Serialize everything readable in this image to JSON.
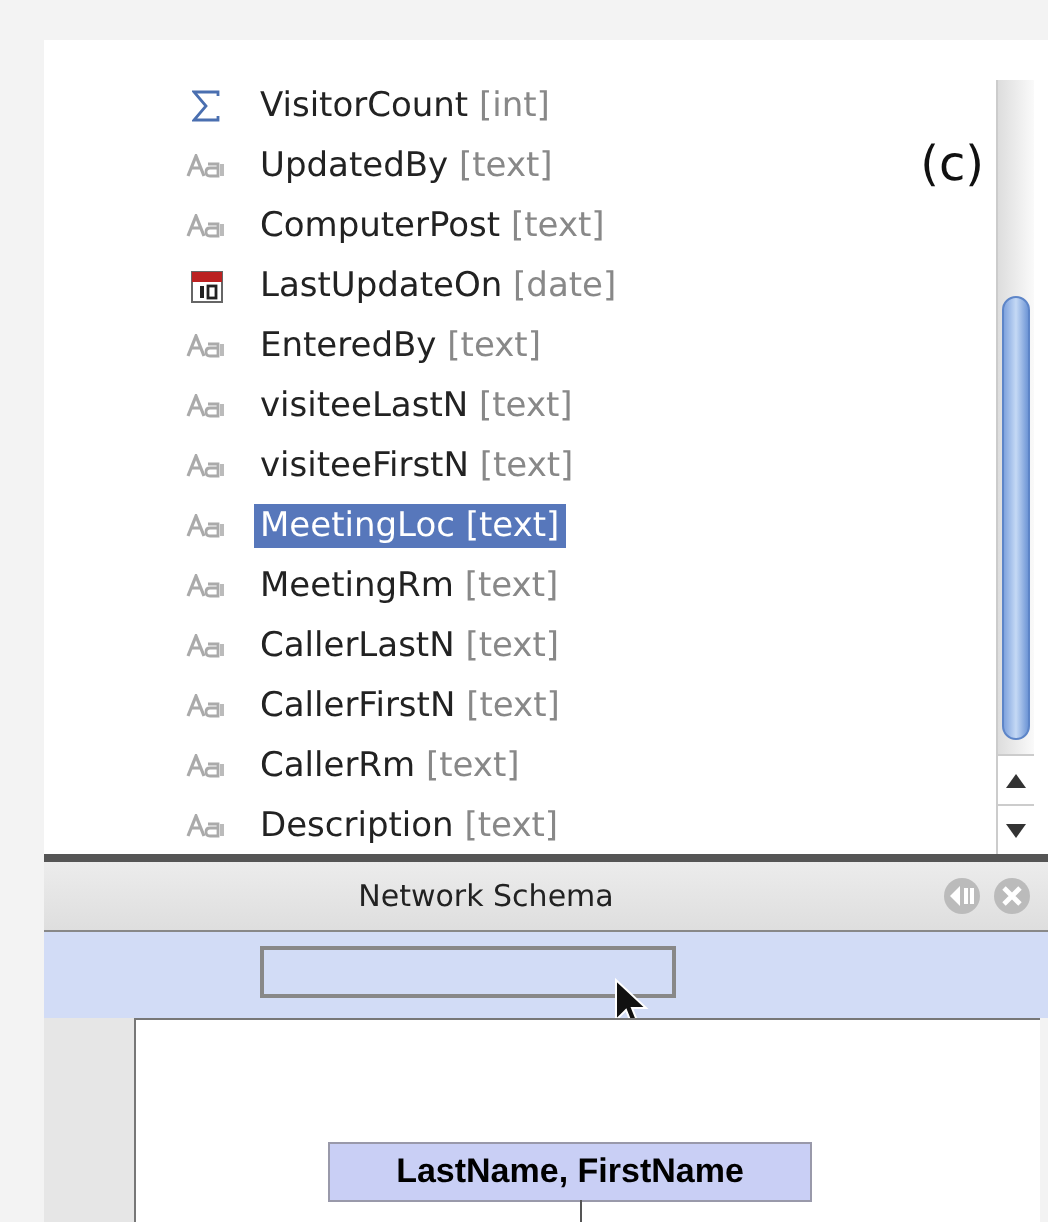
{
  "label": "(c)",
  "fields": [
    {
      "kind": "number",
      "name": "VisitorCount",
      "type": "[int]",
      "selected": false
    },
    {
      "kind": "text",
      "name": "UpdatedBy",
      "type": "[text]",
      "selected": false
    },
    {
      "kind": "text",
      "name": "ComputerPost",
      "type": "[text]",
      "selected": false
    },
    {
      "kind": "date",
      "name": "LastUpdateOn",
      "type": "[date]",
      "selected": false
    },
    {
      "kind": "text",
      "name": "EnteredBy",
      "type": "[text]",
      "selected": false
    },
    {
      "kind": "text",
      "name": "visiteeLastN",
      "type": "[text]",
      "selected": false
    },
    {
      "kind": "text",
      "name": "visiteeFirstN",
      "type": "[text]",
      "selected": false
    },
    {
      "kind": "text",
      "name": "MeetingLoc",
      "type": "[text]",
      "selected": true
    },
    {
      "kind": "text",
      "name": "MeetingRm",
      "type": "[text]",
      "selected": false
    },
    {
      "kind": "text",
      "name": "CallerLastN",
      "type": "[text]",
      "selected": false
    },
    {
      "kind": "text",
      "name": "CallerFirstN",
      "type": "[text]",
      "selected": false
    },
    {
      "kind": "text",
      "name": "CallerRm",
      "type": "[text]",
      "selected": false
    },
    {
      "kind": "text",
      "name": "Description",
      "type": "[text]",
      "selected": false
    }
  ],
  "panel": {
    "title": "Network Schema",
    "node": "LastName, FirstName"
  }
}
